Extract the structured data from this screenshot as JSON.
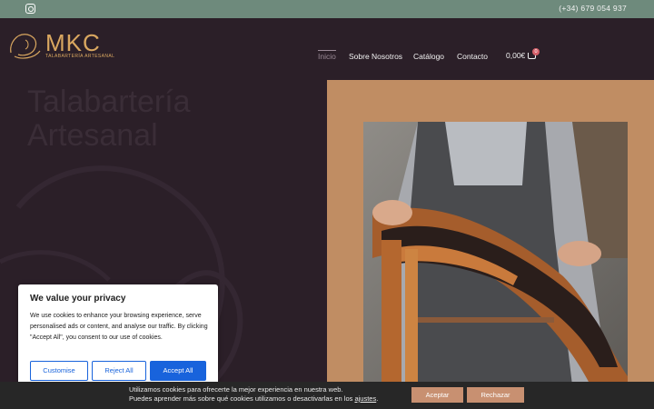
{
  "topbar": {
    "phone": "(+34) 679 054 937",
    "social_icon": "instagram-icon"
  },
  "brand": {
    "name": "MKC",
    "tagline": "TALABARTERÍA ARTESANAL"
  },
  "nav": {
    "items": [
      {
        "label": "Inicio",
        "active": true
      },
      {
        "label": "Sobre Nosotros",
        "active": false
      },
      {
        "label": "Catálogo",
        "active": false
      },
      {
        "label": "Contacto",
        "active": false
      }
    ],
    "cart_total": "0,00€",
    "cart_count": "0"
  },
  "hero": {
    "title_line1": "Talabartería",
    "title_line2": "Artesanal"
  },
  "cookie_consent": {
    "title": "We value your privacy",
    "body": "We use cookies to enhance your browsing experience, serve personalised ads or content, and analyse our traffic. By clicking \"Accept All\", you consent to our use of cookies.",
    "customise_label": "Customise",
    "reject_label": "Reject All",
    "accept_label": "Accept All"
  },
  "cookie_bar": {
    "line1": "Utilizamos cookies para ofrecerte la mejor experiencia en nuestra web.",
    "line2_prefix": "Puedes aprender más sobre qué cookies utilizamos o desactivarlas en los ",
    "line2_link": "ajustes",
    "line2_suffix": ".",
    "accept_label": "Aceptar",
    "reject_label": "Rechazar"
  },
  "colors": {
    "topbar": "#6e8a7c",
    "background": "#2b1f28",
    "brand_gold": "#d9a760",
    "frame": "#c08d63",
    "consent_blue": "#1863dc",
    "bar_button": "#c89071"
  }
}
